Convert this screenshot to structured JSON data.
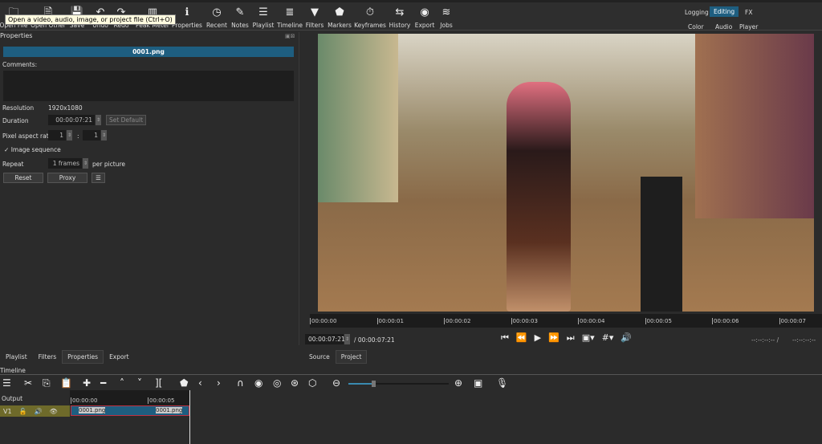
{
  "toolbar": {
    "items": [
      {
        "label": "Open File",
        "icon": "folder-icon"
      },
      {
        "label": "Open Other",
        "icon": "open-other-icon"
      },
      {
        "label": "Save",
        "icon": "save-icon"
      },
      {
        "label": "Undo",
        "icon": "undo-icon"
      },
      {
        "label": "Redo",
        "icon": "redo-icon"
      },
      {
        "label": "Peak Meter",
        "icon": "peak-meter-icon"
      },
      {
        "label": "Properties",
        "icon": "info-icon"
      },
      {
        "label": "Recent",
        "icon": "clock-icon"
      },
      {
        "label": "Notes",
        "icon": "notes-icon"
      },
      {
        "label": "Playlist",
        "icon": "list-icon"
      },
      {
        "label": "Timeline",
        "icon": "timeline-icon"
      },
      {
        "label": "Filters",
        "icon": "filter-icon"
      },
      {
        "label": "Markers",
        "icon": "marker-icon"
      },
      {
        "label": "Keyframes",
        "icon": "stopwatch-icon"
      },
      {
        "label": "History",
        "icon": "history-icon"
      },
      {
        "label": "Export",
        "icon": "disc-icon"
      },
      {
        "label": "Jobs",
        "icon": "database-icon"
      }
    ],
    "tooltip": "Open a video, audio, image, or project file (Ctrl+O)"
  },
  "workspaces": {
    "top": [
      "Logging",
      "Editing",
      "FX"
    ],
    "bottom": [
      "Color",
      "Audio",
      "Player"
    ],
    "active": "Editing",
    "accent": "#1e5e80"
  },
  "properties": {
    "title": "Properties",
    "clip_name": "0001.png",
    "comments_label": "Comments:",
    "resolution_label": "Resolution",
    "resolution": "1920x1080",
    "duration_label": "Duration",
    "duration": "00:00:07:21",
    "set_default": "Set Default",
    "par_label": "Pixel aspect ratio",
    "par_num": "1",
    "par_sep": ":",
    "par_den": "1",
    "image_sequence": "Image sequence",
    "image_sequence_checked": true,
    "repeat_label": "Repeat",
    "repeat": "1 frames",
    "per_picture": "per picture",
    "reset": "Reset",
    "proxy": "Proxy"
  },
  "left_tabs": [
    "Playlist",
    "Filters",
    "Properties",
    "Export"
  ],
  "left_tab_active": "Properties",
  "player": {
    "ruler": [
      "00:00:00",
      "00:00:01",
      "00:00:02",
      "00:00:03",
      "00:00:04",
      "00:00:05",
      "00:00:06",
      "00:00:07"
    ],
    "position": "00:00:07:21",
    "duration": "/ 00:00:07:21",
    "in_point": "--:--:--:-- /",
    "out_point": "--:--:--:--",
    "tabs": [
      "Source",
      "Project"
    ]
  },
  "timeline": {
    "title": "Timeline",
    "output": "Output",
    "track": "V1",
    "ruler": [
      "00:00:00",
      "00:00:05"
    ],
    "clips": [
      "0001.png",
      "0001.png"
    ],
    "zoom_level": 0.25
  }
}
